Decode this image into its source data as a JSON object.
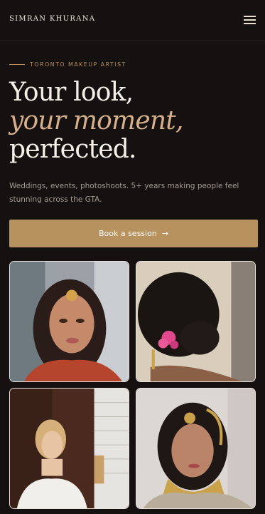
{
  "header": {
    "brand": "SIMRAN KHURANA",
    "menu_icon": "hamburger-menu-icon"
  },
  "hero": {
    "eyebrow": "TORONTO MAKEUP ARTIST",
    "headline_line1": "Your look,",
    "headline_line2": "your moment,",
    "headline_line3": "perfected.",
    "subtext": "Weddings, events, photoshoots. 5+ years making people feel stunning across the GTA.",
    "cta_label": "Book a session",
    "cta_icon": "arrow-right-icon"
  },
  "colors": {
    "background": "#141110",
    "accent_gold": "#b8925e",
    "accent_italic": "#d7af8a"
  },
  "gallery": {
    "photos": [
      {
        "subject": "bridal portrait with maang tikka"
      },
      {
        "subject": "bun hairstyle with pink flowers"
      },
      {
        "subject": "bride in white gown by window"
      },
      {
        "subject": "bridal look with gold jewelry"
      }
    ]
  }
}
